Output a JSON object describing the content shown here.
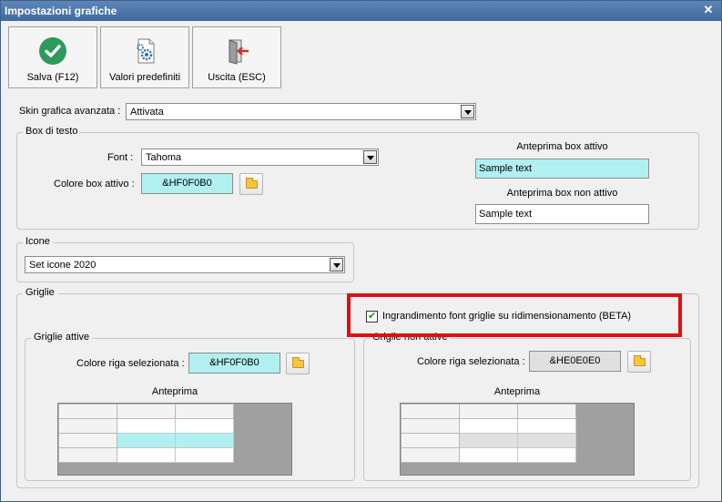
{
  "window": {
    "title": "Impostazioni grafiche"
  },
  "toolbar": {
    "save_label": "Salva (F12)",
    "defaults_label": "Valori predefiniti",
    "exit_label": "Uscita (ESC)"
  },
  "skin": {
    "label": "Skin grafica avanzata :",
    "value": "Attivata"
  },
  "textbox": {
    "legend": "Box di testo",
    "font_label": "Font :",
    "font_value": "Tahoma",
    "active_color_label": "Colore box attivo :",
    "active_color_value": "&HF0F0B0",
    "active_color_hex": "#b0f0f0",
    "preview_active_title": "Anteprima box attivo",
    "preview_active_text": "Sample text",
    "preview_inactive_title": "Anteprima box non attivo",
    "preview_inactive_text": "Sample text"
  },
  "icons": {
    "legend": "Icone",
    "value": "Set icone 2020"
  },
  "grids": {
    "legend": "Griglie",
    "enlarge_checkbox_label": "Ingrandimento font griglie su ridimensionamento (BETA)",
    "enlarge_checked": true,
    "active": {
      "legend": "Griglie attive",
      "row_color_label": "Colore riga selezionata :",
      "row_color_value": "&HF0F0B0",
      "row_color_hex": "#b0f0f0",
      "preview_title": "Anteprima"
    },
    "inactive": {
      "legend": "Griglie non attive",
      "row_color_label": "Colore riga selezionata :",
      "row_color_value": "&HE0E0E0",
      "row_color_hex": "#e0e0e0",
      "preview_title": "Anteprima"
    }
  },
  "icons_semantic": [
    "check-icon",
    "settings-doc-icon",
    "exit-door-icon",
    "folder-icon",
    "close-icon"
  ]
}
